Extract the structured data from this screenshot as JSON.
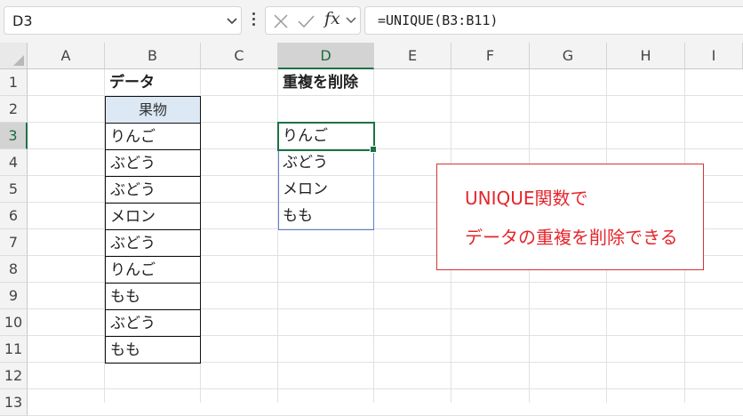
{
  "name_box": {
    "value": "D3"
  },
  "formula_bar": {
    "formula": "=UNIQUE(B3:B11)"
  },
  "toolbar": {
    "cancel_icon": "close-icon",
    "enter_icon": "check-icon",
    "function_icon": "fx-icon",
    "fx_label": "fx"
  },
  "columns": [
    "A",
    "B",
    "C",
    "D",
    "E",
    "F",
    "G",
    "H",
    "I"
  ],
  "rows": [
    "1",
    "2",
    "3",
    "4",
    "5",
    "6",
    "7",
    "8",
    "9",
    "10",
    "11",
    "12",
    "13"
  ],
  "selected": {
    "column": "D",
    "row": "3"
  },
  "cells": {
    "B1": "データ",
    "D1": "重複を削除",
    "B2": "果物",
    "B3": "りんご",
    "B4": "ぶどう",
    "B5": "ぶどう",
    "B6": "メロン",
    "B7": "ぶどう",
    "B8": "りんご",
    "B9": "もも",
    "B10": "ぶどう",
    "B11": "もも",
    "D3": "りんご",
    "D4": "ぶどう",
    "D5": "メロン",
    "D6": "もも"
  },
  "callout": {
    "line1": "UNIQUE関数で",
    "line2": "データの重複を削除できる"
  },
  "colors": {
    "accent_green": "#1e7145",
    "header_fill": "#dce9f5",
    "callout_red": "#e5262c",
    "spill_border": "#5b7fd1"
  }
}
